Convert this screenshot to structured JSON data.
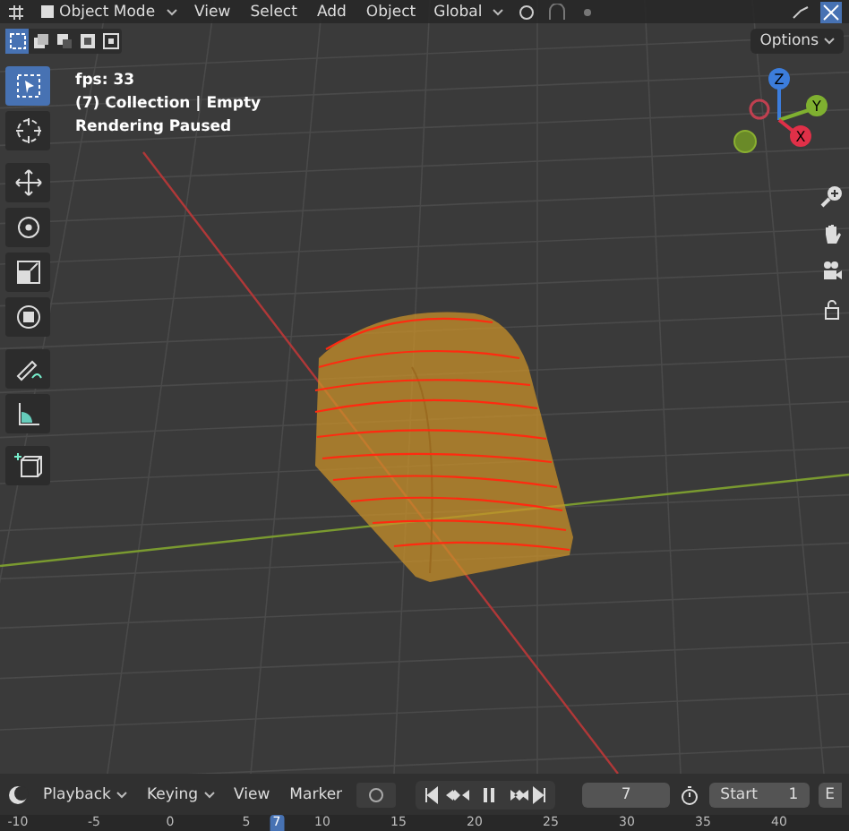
{
  "header": {
    "mode": "Object Mode",
    "menus": [
      "View",
      "Select",
      "Add",
      "Object"
    ],
    "orientation": "Global"
  },
  "select_modes": [
    {
      "kind": "new",
      "selected": true
    },
    {
      "kind": "extend",
      "selected": false
    },
    {
      "kind": "subtract",
      "selected": false
    },
    {
      "kind": "invert",
      "selected": false
    },
    {
      "kind": "intersect",
      "selected": false
    }
  ],
  "options": "Options",
  "overlay_text": [
    "fps: 33",
    "(7) Collection | Empty",
    "Rendering Paused"
  ],
  "tools": [
    {
      "kind": "select",
      "selected": true
    },
    {
      "kind": "cursor",
      "selected": false
    },
    {
      "kind": "move",
      "selected": false
    },
    {
      "kind": "rotate",
      "selected": false
    },
    {
      "kind": "scale",
      "selected": false
    },
    {
      "kind": "transform",
      "selected": false
    },
    {
      "kind": "annotate",
      "selected": false
    },
    {
      "kind": "measure",
      "selected": false
    },
    {
      "kind": "add-cube",
      "selected": false
    }
  ],
  "gizmo": {
    "z": "Z",
    "y": "Y",
    "x": "X"
  },
  "timeline": {
    "menus": [
      "Playback",
      "Keying",
      "View",
      "Marker"
    ],
    "current_frame": "7",
    "start_label": "Start",
    "start": "1",
    "end_label": "E"
  },
  "ruler": [
    {
      "label": "-10",
      "selected": false
    },
    {
      "label": "-5",
      "selected": false
    },
    {
      "label": "0",
      "selected": false
    },
    {
      "label": "5",
      "selected": false
    },
    {
      "label": "7",
      "selected": true
    },
    {
      "label": "10",
      "selected": false
    },
    {
      "label": "15",
      "selected": false
    },
    {
      "label": "20",
      "selected": false
    },
    {
      "label": "25",
      "selected": false
    },
    {
      "label": "30",
      "selected": false
    },
    {
      "label": "35",
      "selected": false
    },
    {
      "label": "40",
      "selected": false
    }
  ]
}
